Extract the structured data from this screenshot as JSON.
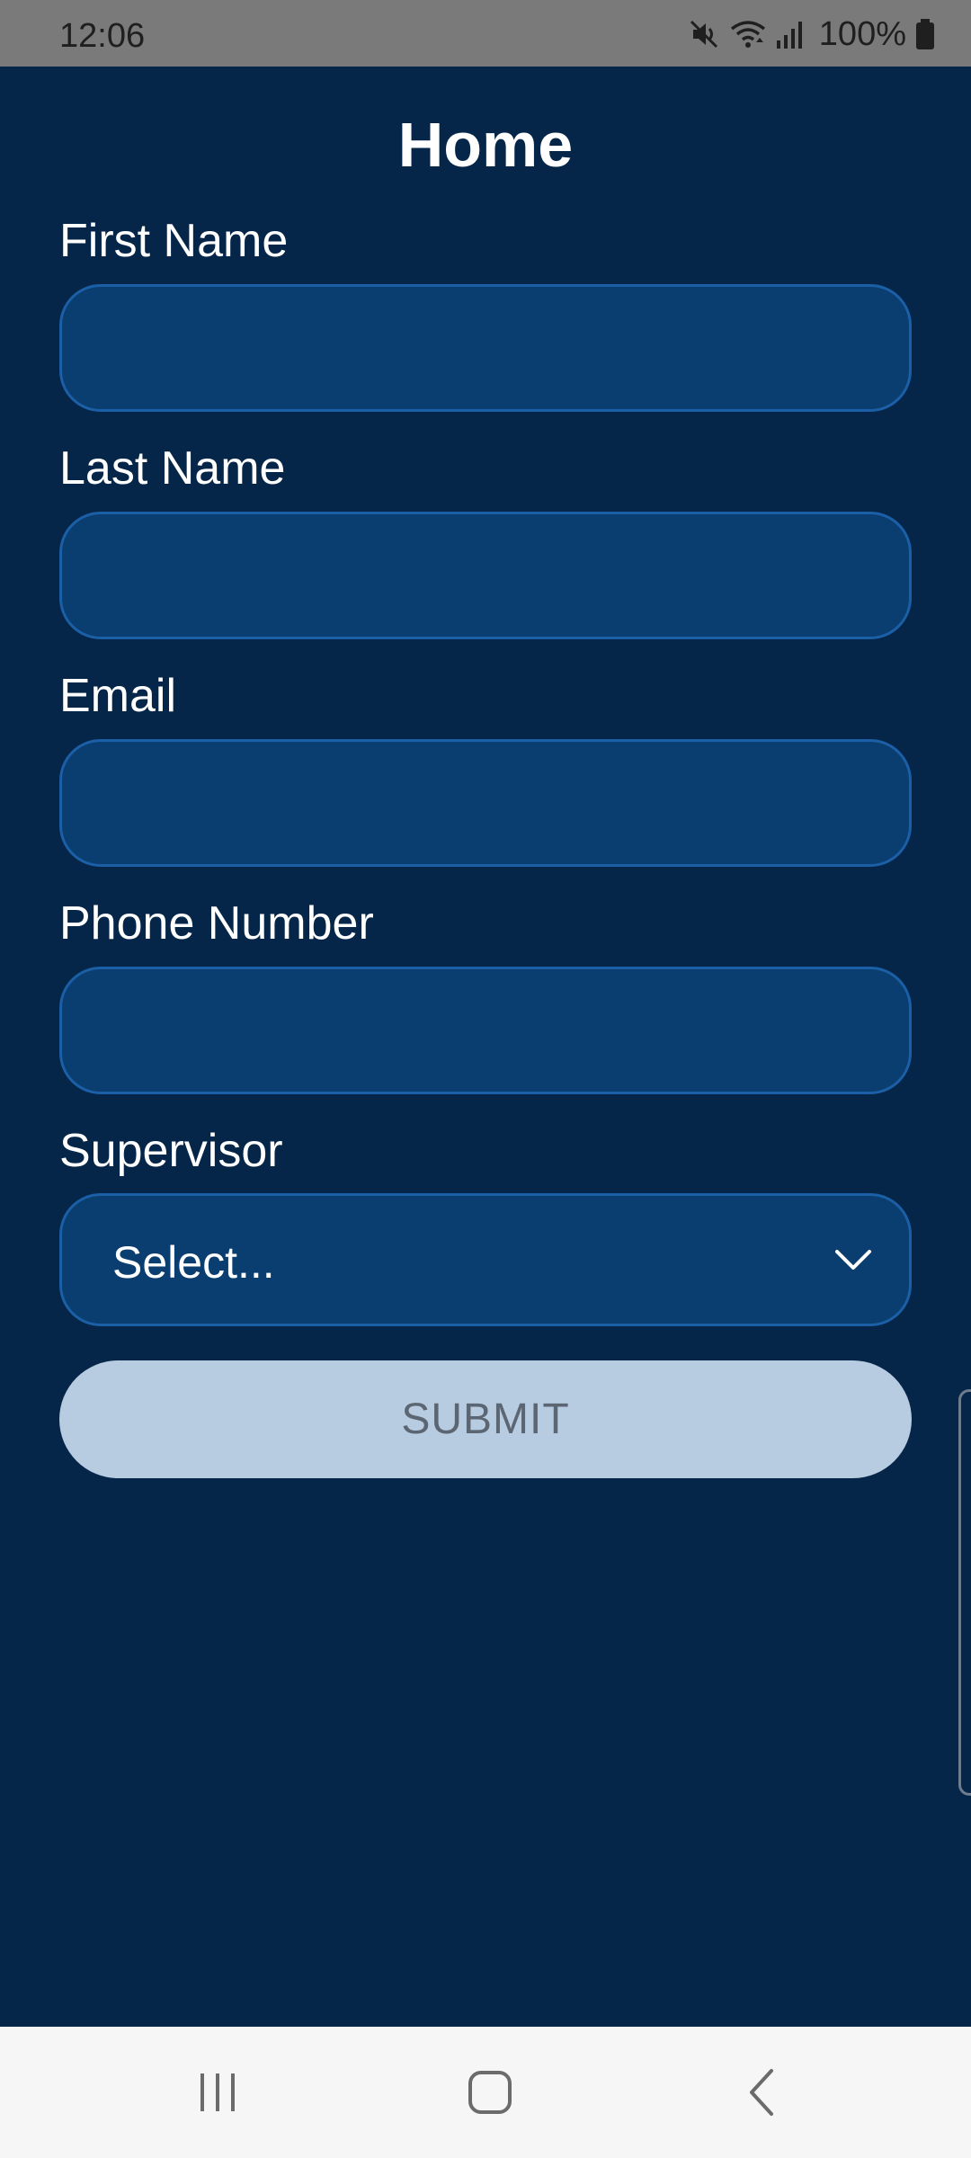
{
  "status_bar": {
    "time": "12:06",
    "battery": "100%",
    "icons": [
      "mute-icon",
      "wifi-icon",
      "signal-icon",
      "battery-icon"
    ]
  },
  "header": {
    "title": "Home"
  },
  "form": {
    "first_name": {
      "label": "First Name",
      "value": ""
    },
    "last_name": {
      "label": "Last Name",
      "value": ""
    },
    "email": {
      "label": "Email",
      "value": ""
    },
    "phone": {
      "label": "Phone Number",
      "value": ""
    },
    "supervisor": {
      "label": "Supervisor",
      "selected": "Select..."
    },
    "submit_label": "SUBMIT"
  },
  "nav_bar": {
    "icons": [
      "recents-icon",
      "home-icon",
      "back-icon"
    ]
  },
  "colors": {
    "background": "#062649",
    "input_fill": "#0b3e70",
    "input_border": "#1b5fa6",
    "submit_fill": "#b7cbe1",
    "submit_text": "#5b6672"
  }
}
